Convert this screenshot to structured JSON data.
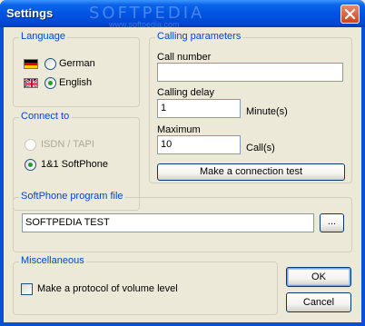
{
  "window": {
    "title": "Settings",
    "watermark": "SOFTPEDIA",
    "watermark_sub": "www.softpedia.com"
  },
  "language": {
    "label": "Language",
    "options": [
      {
        "label": "German",
        "selected": false,
        "icon": "german-flag-icon"
      },
      {
        "label": "English",
        "selected": true,
        "icon": "uk-flag-icon"
      }
    ]
  },
  "connect_to": {
    "label": "Connect to",
    "options": [
      {
        "label": "ISDN / TAPI",
        "selected": false,
        "enabled": false
      },
      {
        "label": "1&1 SoftPhone",
        "selected": true,
        "enabled": true
      }
    ]
  },
  "calling_parameters": {
    "label": "Calling parameters",
    "call_number_label": "Call number",
    "call_number_value": "",
    "calling_delay_label": "Calling delay",
    "calling_delay_value": "1",
    "calling_delay_unit": "Minute(s)",
    "maximum_label": "Maximum",
    "maximum_value": "10",
    "maximum_unit": "Call(s)",
    "test_button": "Make a connection test"
  },
  "softphone": {
    "label": "SoftPhone program file",
    "path_value": "SOFTPEDIA TEST",
    "browse_button": "..."
  },
  "miscellaneous": {
    "label": "Miscellaneous",
    "volume_checkbox_label": "Make a protocol of volume level",
    "volume_checked": false
  },
  "buttons": {
    "ok": "OK",
    "cancel": "Cancel"
  },
  "colors": {
    "titlebar": "#0054e3",
    "group_label": "#0046d5",
    "dialog_bg": "#ece9d8",
    "radio_dot": "#21a121"
  }
}
